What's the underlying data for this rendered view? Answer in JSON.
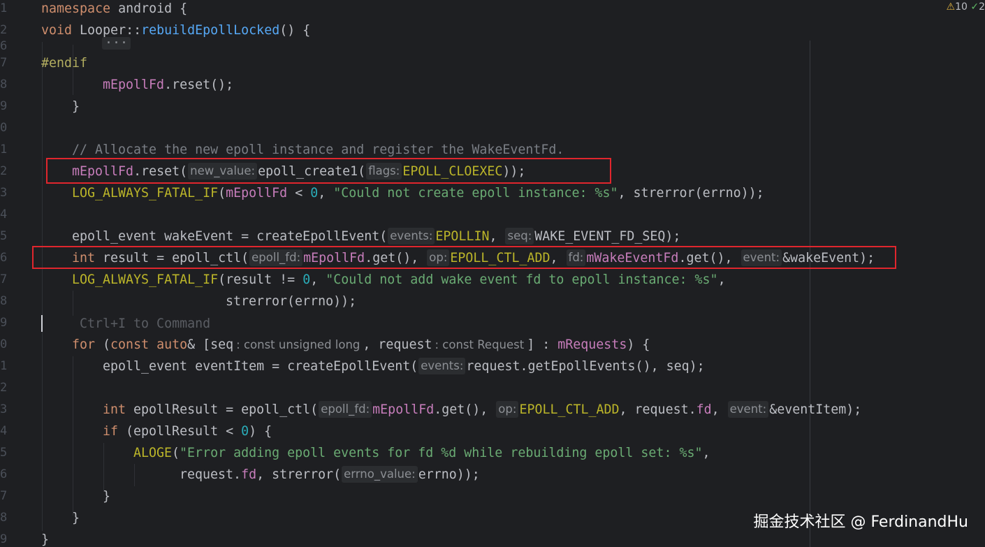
{
  "gutter": {
    "line_numbers": [
      "1",
      "2",
      "6",
      "7",
      "8",
      "9",
      "0",
      "1",
      "2",
      "3",
      "4",
      "5",
      "6",
      "7",
      "8",
      "9",
      "0",
      "1",
      "2",
      "3",
      "4",
      "5",
      "6",
      "7",
      "8",
      "9"
    ]
  },
  "status": {
    "warning_icon": "warning-triangle-icon",
    "warning_count": "10",
    "ok_icon": "checkmark-icon",
    "ok_count": "2"
  },
  "colors": {
    "background": "#1e1f22",
    "keyword": "#cf8e6d",
    "function": "#56a8f5",
    "member": "#c77dbb",
    "macro": "#bbb529",
    "string": "#6aab73",
    "number": "#2aacb8",
    "comment": "#7a7e85",
    "highlight_box": "#e0262d"
  },
  "code": {
    "l1": {
      "kw": "namespace",
      "rest": " android {"
    },
    "l2": {
      "kw": "void",
      "cls": " Looper::",
      "fn": "rebuildEpollLocked",
      "rest": "() {"
    },
    "l3": {
      "fold": "···"
    },
    "l4": {
      "pp": "#endif"
    },
    "l5": {
      "mem": "mEpollFd",
      "rest": ".reset();"
    },
    "l6": {
      "rest": "}"
    },
    "l7": {
      "cmt": "// Allocate the new epoll instance and register the WakeEventFd."
    },
    "l8": {
      "mem": "mEpollFd",
      "a": ".reset(",
      "hint1": "new_value:",
      "b": "epoll_create1(",
      "hint2": "flags:",
      "mac": "EPOLL_CLOEXEC",
      "c": "));"
    },
    "l9": {
      "mac": "LOG_ALWAYS_FATAL_IF",
      "a": "(",
      "mem": "mEpollFd",
      "b": " < ",
      "num": "0",
      "c": ", ",
      "str": "\"Could not create epoll instance: %s\"",
      "d": ", strerror(errno));"
    },
    "l10": {
      "a": "epoll_event wakeEvent = createEpollEvent(",
      "hint1": "events:",
      "mac1": "EPOLLIN",
      "b": ", ",
      "hint2": "seq:",
      "c": "WAKE_EVENT_FD_SEQ);"
    },
    "l11": {
      "kw": "int",
      "a": " result = epoll_ctl(",
      "hint1": "epoll_fd:",
      "mem1": "mEpollFd",
      "b": ".get(), ",
      "hint2": "op:",
      "mac": "EPOLL_CTL_ADD",
      "c": ", ",
      "hint3": "fd:",
      "mem2": "mWakeEventFd",
      "d": ".get(), ",
      "hint4": "event:",
      "e": "&wakeEvent);"
    },
    "l12": {
      "mac": "LOG_ALWAYS_FATAL_IF",
      "a": "(result != ",
      "num": "0",
      "b": ", ",
      "str": "\"Could not add wake event fd to epoll instance: %s\"",
      "c": ","
    },
    "l13": {
      "a": "strerror(errno));"
    },
    "l14": {
      "ghost": "Ctrl+I to Command"
    },
    "l15": {
      "kw1": "for",
      "a": " (",
      "kw2": "const auto",
      "b": "& [seq",
      "hint1": ": const unsigned long",
      "c": ", request",
      "hint2": ": const Request",
      "d": "] : ",
      "mem": "mRequests",
      "e": ") {"
    },
    "l16": {
      "a": "epoll_event eventItem = createEpollEvent(",
      "hint1": "events:",
      "b": "request.getEpollEvents(), seq);"
    },
    "l17": {
      "kw": "int",
      "a": " epollResult = epoll_ctl(",
      "hint1": "epoll_fd:",
      "mem": "mEpollFd",
      "b": ".get(), ",
      "hint2": "op:",
      "mac": "EPOLL_CTL_ADD",
      "c": ", request.",
      "mem2": "fd",
      "d": ", ",
      "hint3": "event:",
      "e": "&eventItem);"
    },
    "l18": {
      "kw": "if",
      "a": " (epollResult < ",
      "num": "0",
      "b": ") {"
    },
    "l19": {
      "mac": "ALOGE",
      "a": "(",
      "str": "\"Error adding epoll events for fd %d while rebuilding epoll set: %s\"",
      "b": ","
    },
    "l20": {
      "a": "request.",
      "mem": "fd",
      "b": ", strerror(",
      "hint1": "errno_value:",
      "c": "errno));"
    },
    "l21": {
      "a": "}"
    },
    "l22": {
      "a": "}"
    },
    "l23": {
      "a": "}"
    }
  },
  "watermark": "掘金技术社区 @ FerdinandHu"
}
